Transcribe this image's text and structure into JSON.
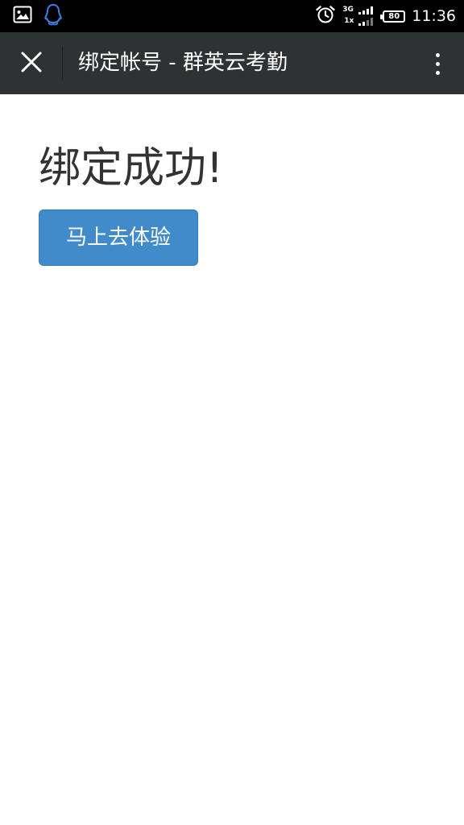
{
  "status_bar": {
    "left_icons": [
      "image-notification-icon",
      "qq-penguin-icon"
    ],
    "right_icons": [
      "alarm-clock-icon",
      "signal-icon",
      "battery-icon"
    ],
    "network_top": "3G",
    "network_bottom": "1x",
    "battery_level": "80",
    "time": "11:36"
  },
  "app_bar": {
    "title": "绑定帐号 - 群英云考勤",
    "close_icon": "close-icon",
    "menu_icon": "more-vertical-icon",
    "background_color": "#2f3233"
  },
  "main": {
    "heading": "绑定成功!",
    "button_label": "马上去体验",
    "button_color": "#428bca"
  }
}
